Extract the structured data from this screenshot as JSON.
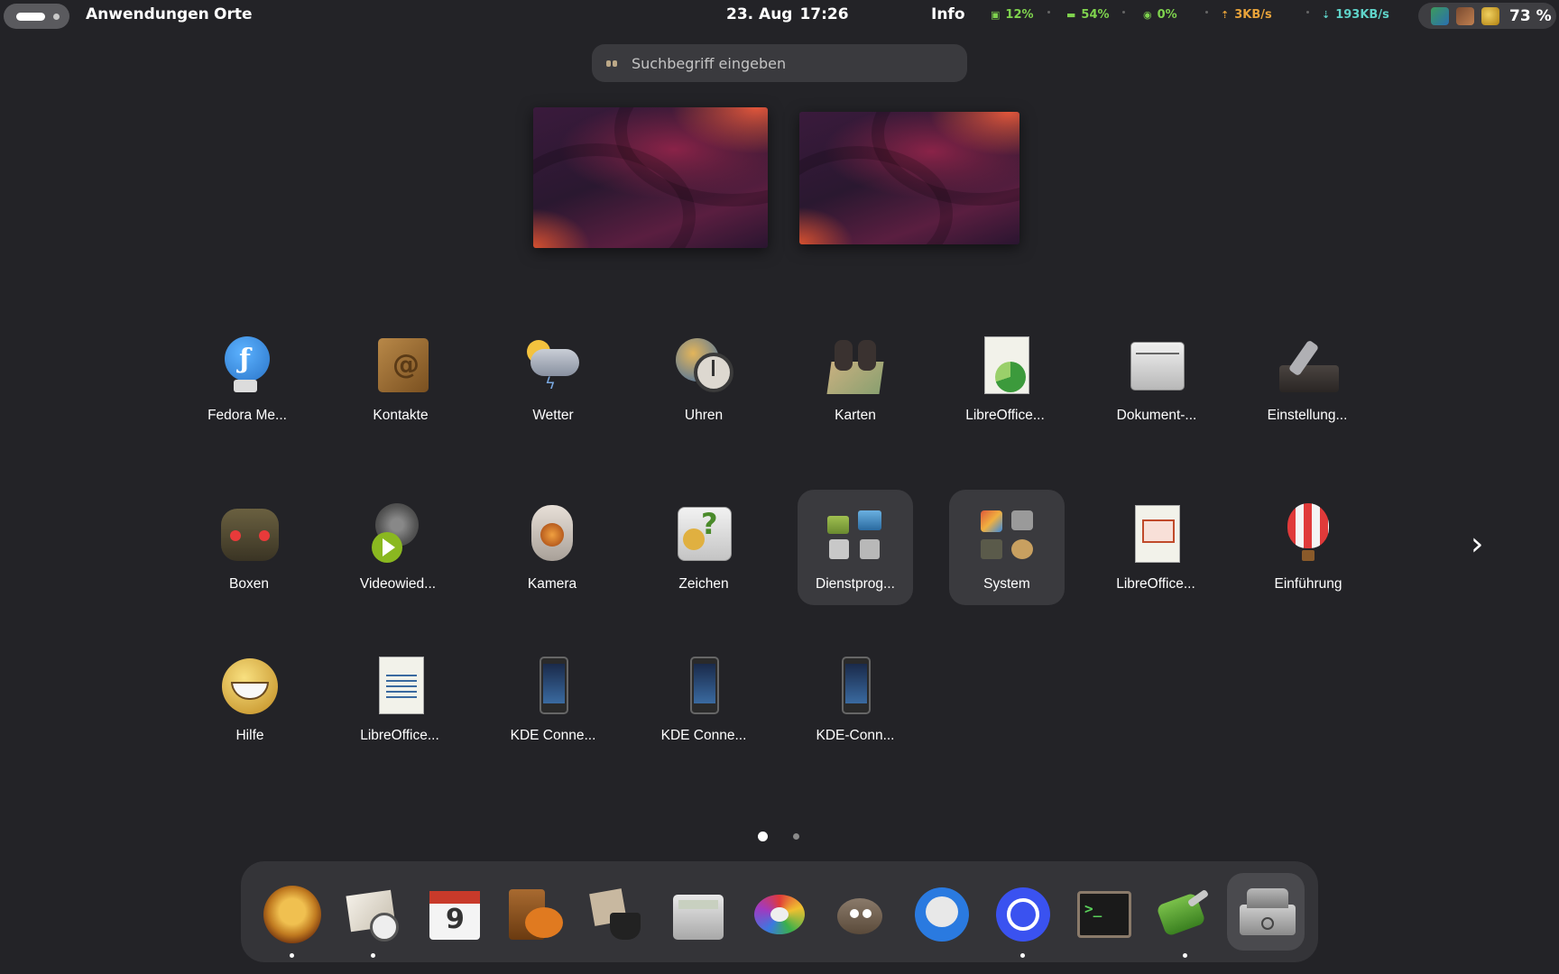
{
  "topbar": {
    "menu_applications": "Anwendungen",
    "menu_places": "Orte",
    "date": "23. Aug",
    "time": "17:26",
    "info": "Info",
    "cpu": "12%",
    "ram": "54%",
    "disk": "0%",
    "upload": "3KB/s",
    "download": "193KB/s",
    "battery": "73 %"
  },
  "search": {
    "placeholder": "Suchbegriff eingeben"
  },
  "apps": {
    "fedora": "Fedora Me...",
    "kontakte": "Kontakte",
    "wetter": "Wetter",
    "uhren": "Uhren",
    "karten": "Karten",
    "libreoffice_calc": "LibreOffice...",
    "dokument": "Dokument-...",
    "einstellungen": "Einstellung...",
    "boxen": "Boxen",
    "videowied": "Videowied...",
    "kamera": "Kamera",
    "zeichen": "Zeichen",
    "dienstprog": "Dienstprog...",
    "system": "System",
    "libreoffice_impress": "LibreOffice...",
    "einfuehrung": "Einführung",
    "hilfe": "Hilfe",
    "libreoffice_writer": "LibreOffice...",
    "kde_connect_1": "KDE Conne...",
    "kde_connect_2": "KDE Conne...",
    "kde_connect_3": "KDE-Conn..."
  },
  "pagination": {
    "pages": 2,
    "current": 1
  },
  "colors": {
    "background": "#232327",
    "stat_green": "#7fd34e",
    "stat_orange": "#e8a33a",
    "stat_cyan": "#5fd3c9"
  }
}
